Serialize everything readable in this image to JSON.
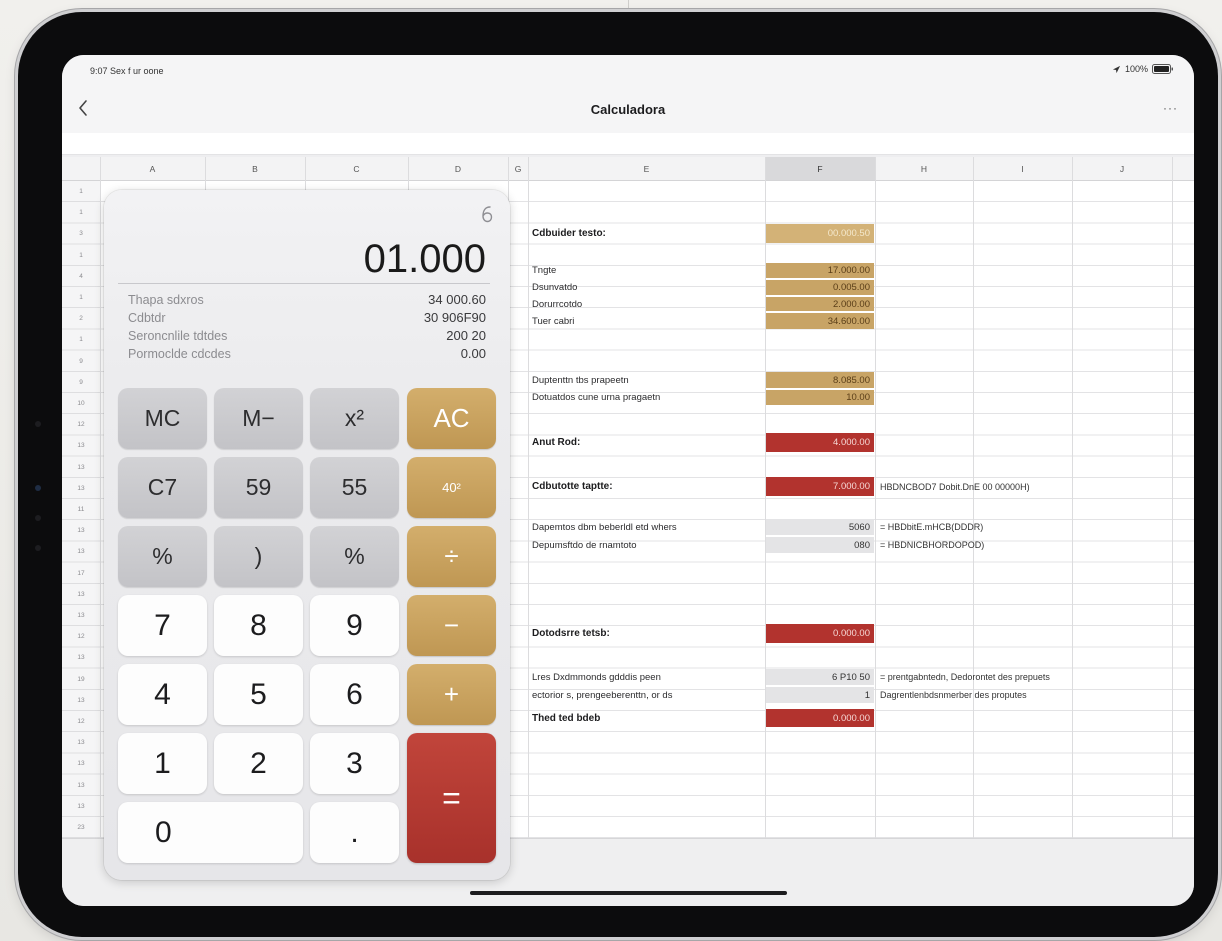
{
  "status_bar": {
    "left_text": "9:07  Sex f ur oone",
    "battery_text": "100%",
    "signal_icon": "location-icon",
    "battery_icon": "battery-icon"
  },
  "nav": {
    "back_icon": "chevron-left-icon",
    "title": "Calculadora",
    "more_label": "···"
  },
  "sheet": {
    "columns": [
      "A",
      "B",
      "C",
      "D",
      "G",
      "E",
      "F",
      "H",
      "I",
      "J"
    ],
    "row_numbers": [
      "1",
      "1",
      "3",
      "1",
      "4",
      "1",
      "2",
      "1",
      "9",
      "9",
      "10",
      "12",
      "13",
      "13",
      "13",
      "11",
      "13",
      "13",
      "17",
      "13",
      "13",
      "12",
      "13",
      "19",
      "13",
      "12",
      "13",
      "13",
      "13",
      "13",
      "23"
    ],
    "entries": [
      {
        "label": "Cdbuider testo:",
        "value": "00.000.50"
      },
      {
        "label": "Tngte",
        "value": "17.000.00"
      },
      {
        "label": "Dsunvatdo",
        "value": "0.005.00"
      },
      {
        "label": "Dorurrcotdo",
        "value": "2.000.00"
      },
      {
        "label": "Tuer cabri",
        "value": "34.600.00"
      },
      {
        "label": "Duptenttn tbs prapeetn",
        "value": "8.085.00"
      },
      {
        "label": "Dotuatdos cune urna pragaetn",
        "value": "10.00"
      },
      {
        "label": "Anut Rod:",
        "value": "4.000.00"
      },
      {
        "label": "Cdbutotte taptte:",
        "value": "7.000.00",
        "note": "HBDNCBOD7 Dobit.DnE 00 00000H)"
      },
      {
        "label": "Dapemtos dbm beberldl etd whers",
        "value": "5060",
        "note": "= HBDbitE.mHCB(DDDR)"
      },
      {
        "label": "Depumsftdo de rnamtoto",
        "value": "080",
        "note": "= HBDNICBHORDOPOD)"
      },
      {
        "label": "Dotodsrre tetsb:",
        "value": "0.000.00"
      },
      {
        "label": "Lres Dxdmmonds gdddis peen",
        "value": "6 P10 50",
        "note": "= prentgabntedn, Dedorontet des prepuets"
      },
      {
        "label": "ectorior s, prengeeberenttn, or ds",
        "value": "1",
        "note": "Dagrentlenbdsnmerber des proputes"
      },
      {
        "label": "Thed ted bdeb",
        "value": "0.000.00"
      }
    ]
  },
  "calculator": {
    "history_icon": "history-icon",
    "display": "01.000",
    "memory": [
      {
        "label": "Thapa sdxros",
        "value": "34 000.60"
      },
      {
        "label": "Cdbtdr",
        "value": "30 906F90"
      },
      {
        "label": "Seroncnlile tdtdes",
        "value": "200 20"
      },
      {
        "label": "Pormoclde cdcdes",
        "value": "0.00"
      }
    ],
    "keys": [
      "MC",
      "M−",
      "x²",
      "AC",
      "C7",
      "59",
      "55",
      "40²",
      "%",
      ")",
      "%",
      "÷",
      "7",
      "8",
      "9",
      "−",
      "4",
      "5",
      "6",
      "+",
      "1",
      "2",
      "3",
      "=",
      "0",
      "."
    ]
  },
  "colors": {
    "gold": "#c8a466",
    "gold_light": "#d3b277",
    "red": "#b2332e",
    "function_key": "#c9c9cc",
    "selected_column": "#d9d9db"
  }
}
